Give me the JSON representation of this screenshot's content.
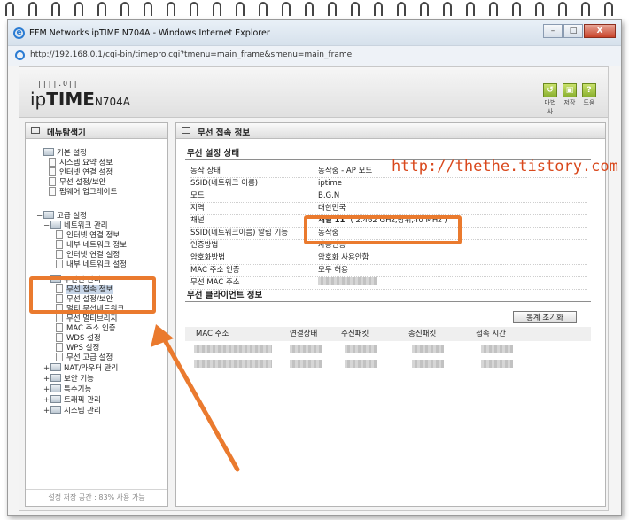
{
  "window": {
    "title": "EFM Networks ipTIME N704A - Windows Internet Explorer",
    "url": "http://192.168.0.1/cgi-bin/timepro.cgi?tmenu=main_frame&smenu=main_frame",
    "minimize": "–",
    "maximize": "□",
    "close": "X"
  },
  "header": {
    "logo_dots": "||||.O||",
    "logo_brand_light": "ip",
    "logo_brand_bold": "TIME",
    "logo_model": "N704A",
    "tools": [
      {
        "label": "마법사",
        "icon": "wizard-icon",
        "glyph": "↺"
      },
      {
        "label": "저장",
        "icon": "save-icon",
        "glyph": "▣"
      },
      {
        "label": "도움",
        "icon": "help-icon",
        "glyph": "?"
      }
    ]
  },
  "menu_panel": {
    "title": "메뉴탐색기",
    "footer": "설정 저장 공간 : 83% 사용 가능",
    "items": [
      {
        "label": "기본 설정",
        "level": 0,
        "type": "folder",
        "toggle": ""
      },
      {
        "label": "시스템 요약 정보",
        "level": 1,
        "type": "page"
      },
      {
        "label": "인터넷 연결 설정",
        "level": 1,
        "type": "page"
      },
      {
        "label": "무선 설정/보안",
        "level": 1,
        "type": "page"
      },
      {
        "label": "펌웨어 업그레이드",
        "level": 1,
        "type": "page"
      },
      {
        "label": "고급 설정",
        "level": 0,
        "type": "folder",
        "toggle": "−"
      },
      {
        "label": "네트워크 관리",
        "level": 1,
        "type": "folder",
        "toggle": "−"
      },
      {
        "label": "인터넷 연결 정보",
        "level": 2,
        "type": "page"
      },
      {
        "label": "내부 네트워크 정보",
        "level": 2,
        "type": "page"
      },
      {
        "label": "인터넷 연결 설정",
        "level": 2,
        "type": "page"
      },
      {
        "label": "내부 네트워크 설정",
        "level": 2,
        "type": "page"
      },
      {
        "label": "무선랜 관리",
        "level": 1,
        "type": "folder",
        "toggle": "−"
      },
      {
        "label": "무선 접속 정보",
        "level": 2,
        "type": "page",
        "selected": true
      },
      {
        "label": "무선 설정/보안",
        "level": 2,
        "type": "page"
      },
      {
        "label": "멀티 무선네트워크",
        "level": 2,
        "type": "page"
      },
      {
        "label": "무선 멀티브리지",
        "level": 2,
        "type": "page"
      },
      {
        "label": "MAC 주소 인증",
        "level": 2,
        "type": "page"
      },
      {
        "label": "WDS 설정",
        "level": 2,
        "type": "page"
      },
      {
        "label": "WPS 설정",
        "level": 2,
        "type": "page"
      },
      {
        "label": "무선 고급 설정",
        "level": 2,
        "type": "page"
      },
      {
        "label": "NAT/라우터 관리",
        "level": 1,
        "type": "folder",
        "toggle": "+"
      },
      {
        "label": "보안 기능",
        "level": 1,
        "type": "folder",
        "toggle": "+"
      },
      {
        "label": "특수기능",
        "level": 1,
        "type": "folder",
        "toggle": "+"
      },
      {
        "label": "트래픽 관리",
        "level": 1,
        "type": "folder",
        "toggle": "+"
      },
      {
        "label": "시스템 관리",
        "level": 1,
        "type": "folder",
        "toggle": "+"
      }
    ]
  },
  "content": {
    "title": "무선 접속 정보",
    "status_section": "무선 설정 상태",
    "status_rows": [
      {
        "key": "동작 상태",
        "value": "동작중 - AP 모드"
      },
      {
        "key": "SSID(네트워크 이름)",
        "value": "iptime"
      },
      {
        "key": "모드",
        "value": "B,G,N"
      },
      {
        "key": "지역",
        "value": "대한민국"
      },
      {
        "key": "채널",
        "value_bold": "채널 11",
        "value_extra": "( 2.462 GHz,상위,40 MHz )"
      },
      {
        "key": "SSID(네트워크이름) 알림 기능",
        "value": "동작중"
      },
      {
        "key": "인증방법",
        "value": "자동인증"
      },
      {
        "key": "암호화방법",
        "value": "암호화 사용안함"
      },
      {
        "key": "MAC 주소 인증",
        "value": "모두 허용"
      },
      {
        "key": "무선 MAC 주소",
        "value": ""
      }
    ],
    "client_section": "무선 클라이언트 정보",
    "reset_button": "통계 초기화",
    "client_headers": [
      "MAC 주소",
      "연결상태",
      "수신패킷",
      "송신패킷",
      "접속 시간"
    ]
  },
  "annotation": {
    "watermark": "http://thethe.tistory.com",
    "highlight_color": "#ea7a2e",
    "watermark_color": "#d9481c"
  }
}
